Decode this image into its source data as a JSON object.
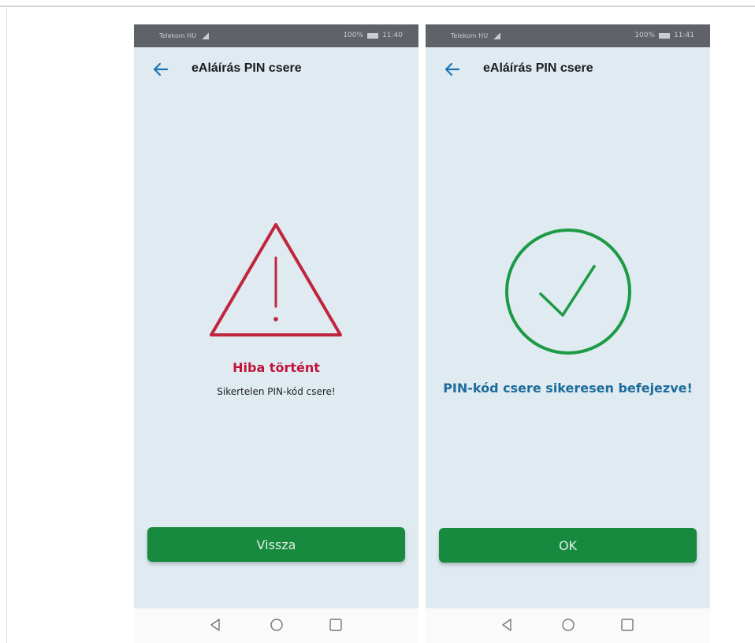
{
  "screens": [
    {
      "status": {
        "carrier": "Telekom HU",
        "battery": "100%",
        "time": "11:40"
      },
      "title": "eAláírás PIN csere",
      "message_title": "Hiba történt",
      "message_text": "Sikertelen PIN-kód csere!",
      "button_label": "Vissza",
      "icon": "warning-triangle-icon",
      "colors": {
        "icon": "#c0253f",
        "title": "#c0143c"
      }
    },
    {
      "status": {
        "carrier": "Telekom HU",
        "battery": "100%",
        "time": "11:41"
      },
      "title": "eAláírás PIN csere",
      "message_title": "PIN-kód csere sikeresen befejezve!",
      "button_label": "OK",
      "icon": "check-circle-icon",
      "colors": {
        "icon": "#1c9a45",
        "title": "#1c6c9c"
      }
    }
  ],
  "theme": {
    "background": "#dfeaf1",
    "accent": "#178a3f",
    "back_arrow": "#1a74b8"
  }
}
